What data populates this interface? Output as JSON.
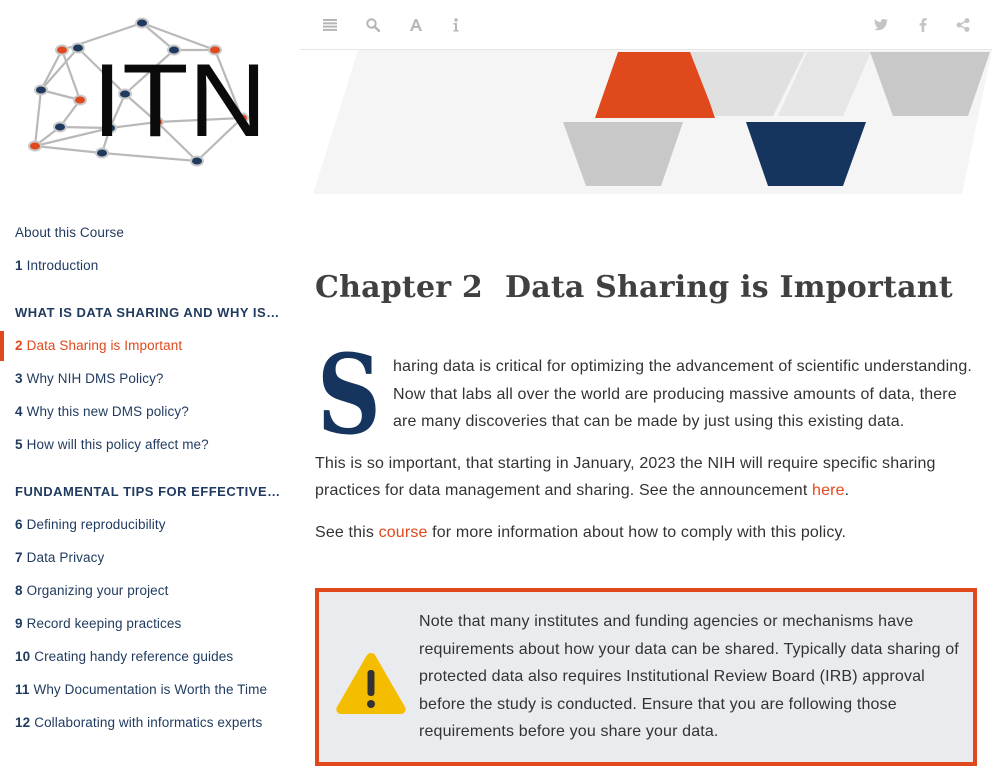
{
  "logo": {
    "text": "ITN"
  },
  "toolbar": {
    "left": [
      {
        "icon": "menu-icon"
      },
      {
        "icon": "search-icon"
      },
      {
        "icon": "font-settings-icon"
      },
      {
        "icon": "info-icon"
      }
    ],
    "right": [
      {
        "icon": "twitter-icon"
      },
      {
        "icon": "facebook-icon"
      },
      {
        "icon": "share-icon"
      }
    ]
  },
  "toc": {
    "about": "About this Course",
    "items": [
      {
        "num": "1",
        "label": "Introduction"
      },
      {
        "part": "WHAT IS DATA SHARING AND WHY IS IT IMPORTANT?"
      },
      {
        "num": "2",
        "label": "Data Sharing is Important",
        "active": true
      },
      {
        "num": "3",
        "label": "Why NIH DMS Policy?"
      },
      {
        "num": "4",
        "label": "Why this new DMS policy?"
      },
      {
        "num": "5",
        "label": "How will this policy affect me?"
      },
      {
        "part": "FUNDAMENTAL TIPS FOR EFFECTIVE DATA SHARING"
      },
      {
        "num": "6",
        "label": "Defining reproducibility"
      },
      {
        "num": "7",
        "label": "Data Privacy"
      },
      {
        "num": "8",
        "label": "Organizing your project"
      },
      {
        "num": "9",
        "label": "Record keeping practices"
      },
      {
        "num": "10",
        "label": "Creating handy reference guides"
      },
      {
        "num": "11",
        "label": "Why Documentation is Worth the Time"
      },
      {
        "num": "12",
        "label": "Collaborating with informatics experts"
      }
    ]
  },
  "chapter": {
    "number": "Chapter 2",
    "title": "Data Sharing is Important"
  },
  "body": {
    "p1_dropcap": "S",
    "p1_rest": "haring data is critical for optimizing the advancement of scientific understanding. Now that labs all over the world are producing massive amounts of data, there are many discoveries that can be made by just using this existing data.",
    "p2_text": "This is so important, that starting in January, 2023 the NIH will require specific sharing practices for data management and sharing. See the announcement ",
    "p2_link": "here",
    "p2_end": ".",
    "p3_start": "See this ",
    "p3_link": "course",
    "p3_end": " for more information about how to comply with this policy."
  },
  "callout": {
    "icon": "warning-icon",
    "text": "Note that many institutes and funding agencies or mechanisms have requirements about how your data can be shared. Typically data sharing of protected data also requires Institutional Review Board (IRB) approval before the study is conducted. Ensure that you are following those requirements before you share your data."
  },
  "colors": {
    "accent": "#e0491b",
    "navy": "#1f3a5e",
    "callout_bg": "#e9ebee",
    "warning": "#f5bd00"
  }
}
